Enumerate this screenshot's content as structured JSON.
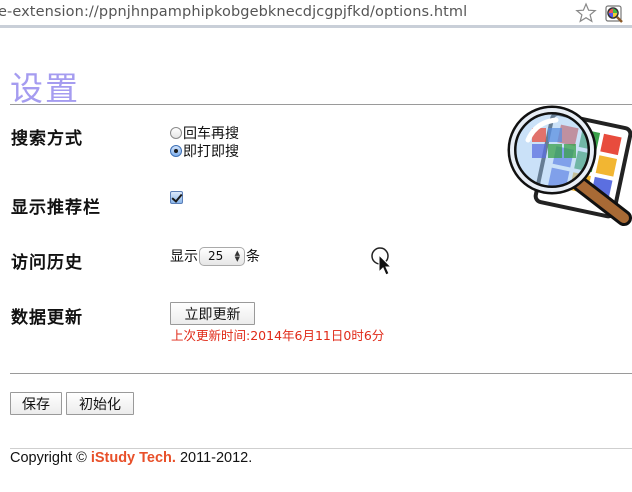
{
  "browser": {
    "url": "e-extension://ppnjhnpamphipkobgebknecdjcgpjfkd/options.html"
  },
  "page": {
    "title": "设置"
  },
  "search_mode": {
    "label": "搜索方式",
    "options": [
      {
        "label": "回车再搜",
        "checked": false
      },
      {
        "label": "即打即搜",
        "checked": true
      }
    ]
  },
  "recommend_bar": {
    "label": "显示推荐栏",
    "checked": true
  },
  "history": {
    "label": "访问历史",
    "prefix": "显示",
    "count": "25",
    "suffix": "条"
  },
  "data_update": {
    "label": "数据更新",
    "button": "立即更新",
    "last_update": "上次更新时间:2014年6月11日0时6分"
  },
  "actions": {
    "save": "保存",
    "reset": "初始化"
  },
  "footer": {
    "prefix": "Copyright © ",
    "brand": "iStudy Tech.",
    "suffix": " 2011-2012."
  },
  "colors": {
    "title": "#a59cf0",
    "warning": "#e02a18",
    "brand": "#e8502a"
  },
  "icons": [
    "star-icon",
    "extension-icon",
    "magnifier-logo-icon",
    "cursor-icon"
  ]
}
